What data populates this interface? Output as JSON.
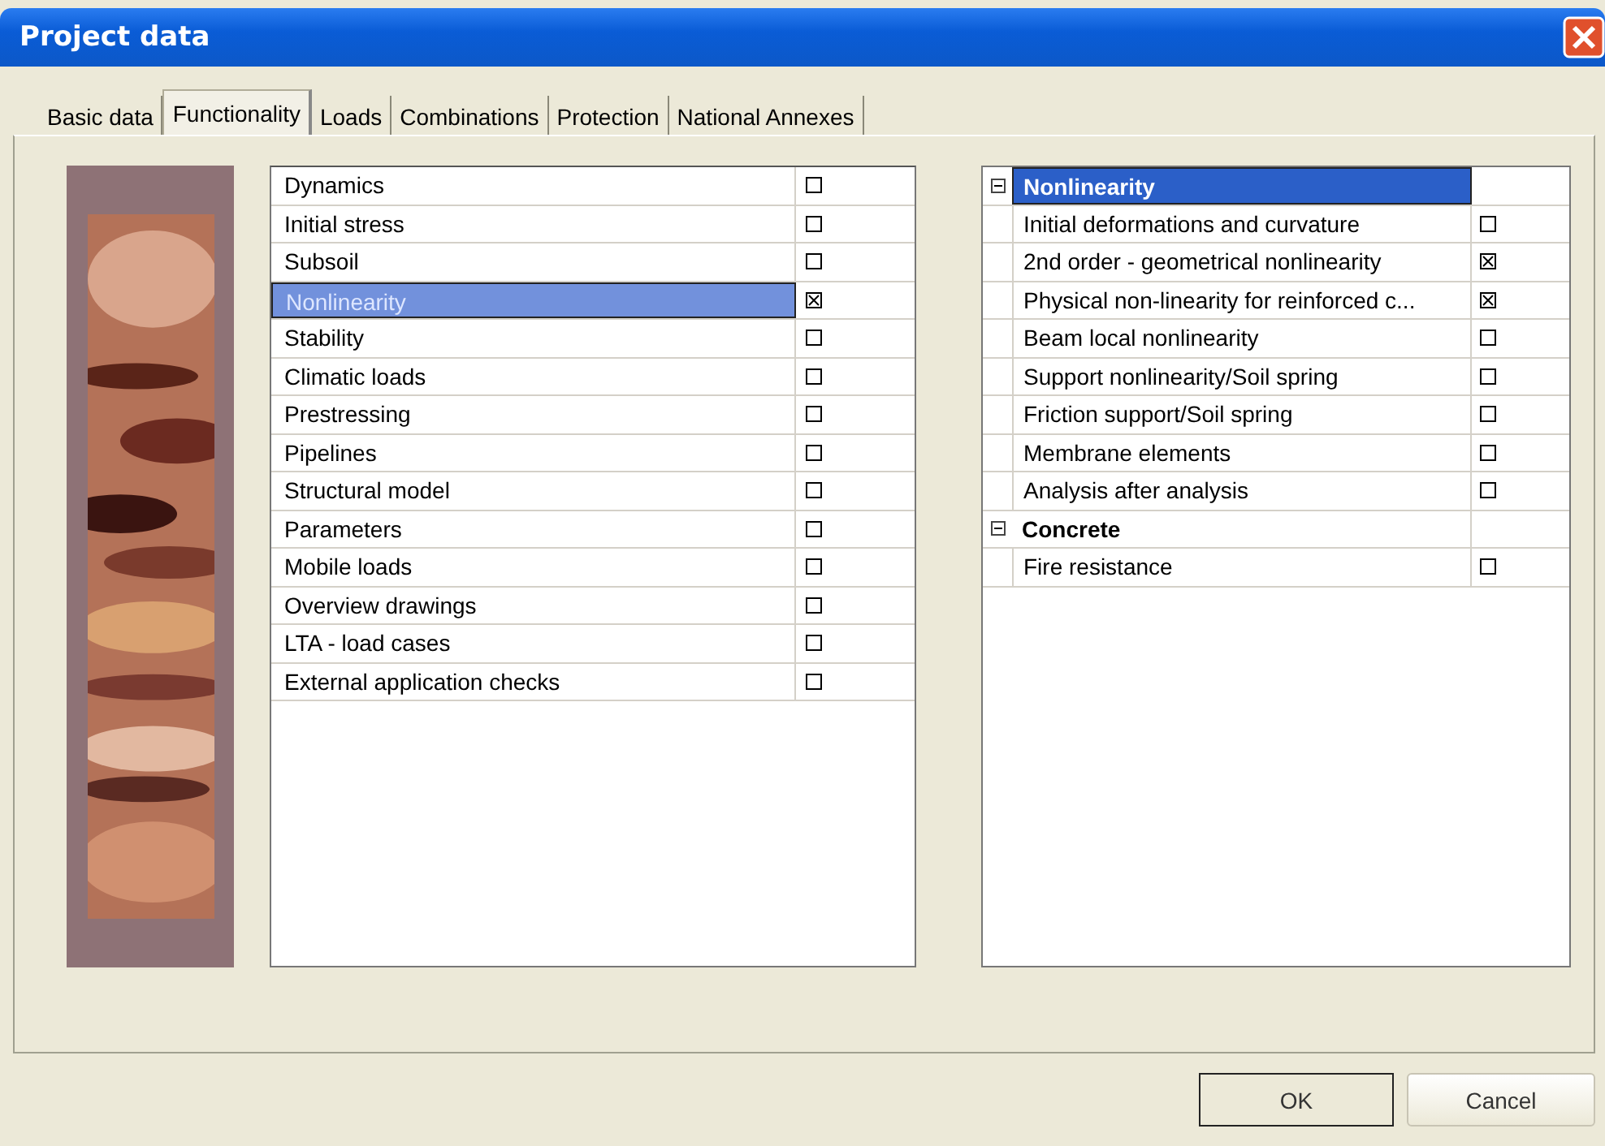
{
  "window": {
    "title": "Project data"
  },
  "tabs": [
    {
      "label": "Basic data",
      "selected": false
    },
    {
      "label": "Functionality",
      "selected": true
    },
    {
      "label": "Loads",
      "selected": false
    },
    {
      "label": "Combinations",
      "selected": false
    },
    {
      "label": "Protection",
      "selected": false
    },
    {
      "label": "National Annexes",
      "selected": false
    }
  ],
  "functions": [
    {
      "label": "Dynamics",
      "checked": false,
      "selected": false
    },
    {
      "label": "Initial stress",
      "checked": false,
      "selected": false
    },
    {
      "label": "Subsoil",
      "checked": false,
      "selected": false
    },
    {
      "label": "Nonlinearity",
      "checked": true,
      "selected": true
    },
    {
      "label": "Stability",
      "checked": false,
      "selected": false
    },
    {
      "label": "Climatic loads",
      "checked": false,
      "selected": false
    },
    {
      "label": "Prestressing",
      "checked": false,
      "selected": false
    },
    {
      "label": "Pipelines",
      "checked": false,
      "selected": false
    },
    {
      "label": "Structural model",
      "checked": false,
      "selected": false
    },
    {
      "label": "Parameters",
      "checked": false,
      "selected": false
    },
    {
      "label": "Mobile loads",
      "checked": false,
      "selected": false
    },
    {
      "label": "Overview drawings",
      "checked": false,
      "selected": false
    },
    {
      "label": "LTA - load cases",
      "checked": false,
      "selected": false
    },
    {
      "label": "External application checks",
      "checked": false,
      "selected": false
    }
  ],
  "options": [
    {
      "label": "Nonlinearity",
      "expanded": true,
      "selected": true,
      "children": [
        {
          "label": "Initial deformations and curvature",
          "checked": false
        },
        {
          "label": "2nd order - geometrical nonlinearity",
          "checked": true
        },
        {
          "label": "Physical non-linearity for reinforced c...",
          "checked": true
        },
        {
          "label": "Beam local nonlinearity",
          "checked": false
        },
        {
          "label": "Support nonlinearity/Soil spring",
          "checked": false
        },
        {
          "label": "Friction support/Soil spring",
          "checked": false
        },
        {
          "label": "Membrane elements",
          "checked": false
        },
        {
          "label": "Analysis after analysis",
          "checked": false
        }
      ]
    },
    {
      "label": "Concrete",
      "expanded": true,
      "selected": false,
      "children": [
        {
          "label": "Fire resistance",
          "checked": false
        }
      ]
    }
  ],
  "buttons": [
    {
      "label": "OK",
      "kind": "default"
    },
    {
      "label": "Cancel",
      "kind": "normal"
    }
  ]
}
